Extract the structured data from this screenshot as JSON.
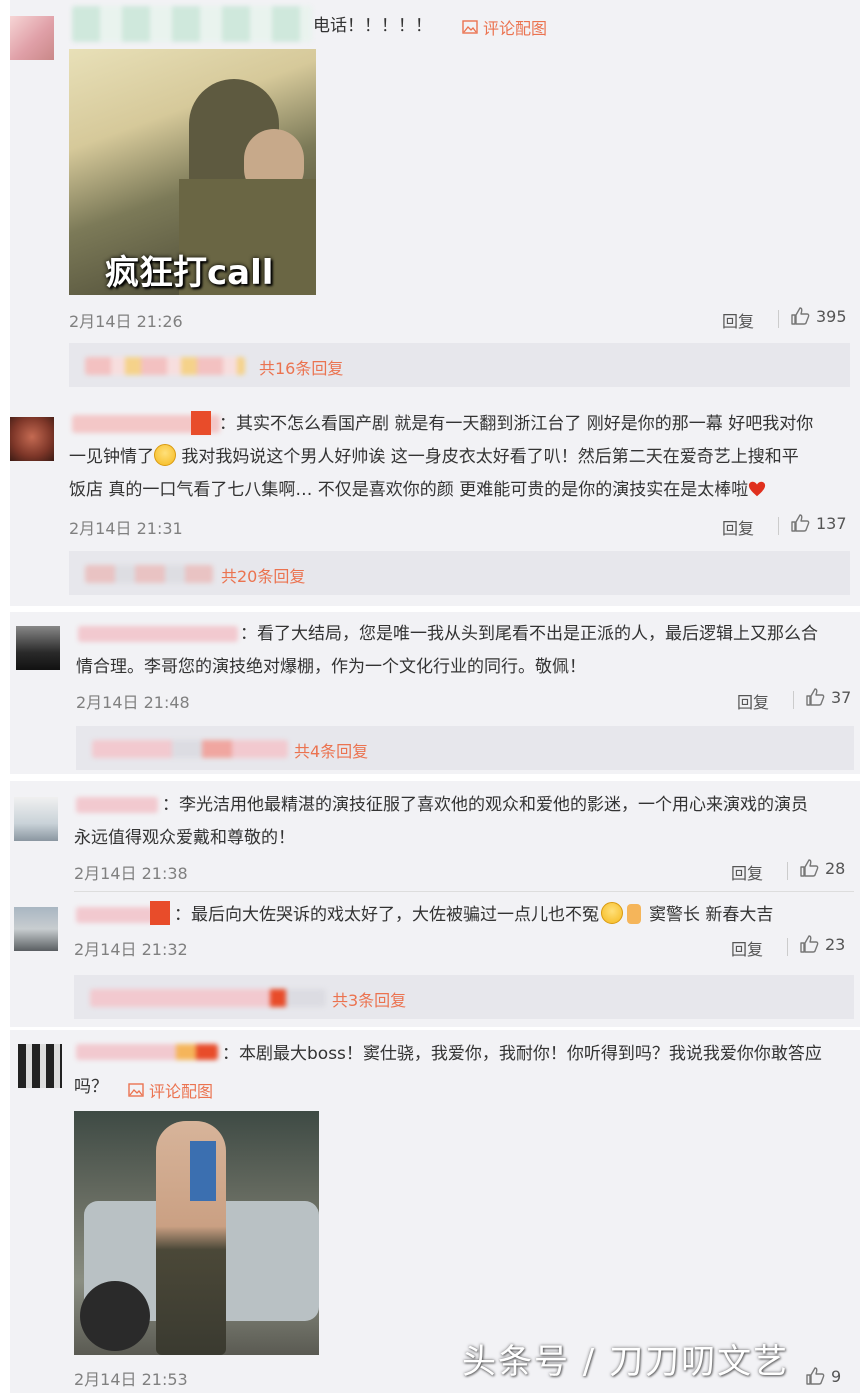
{
  "comments": [
    {
      "text_lines": [
        "电话！！！！！"
      ],
      "image_link": "评论配图",
      "image_caption": "疯狂打call",
      "time": "2月14日 21:26",
      "reply_label": "回复",
      "likes": "395",
      "reply_count": "共16条回复"
    },
    {
      "text_lines": [
        "：其实不怎么看国产剧 就是有一天翻到浙江台了 刚好是你的那一幕 好吧我对你",
        "一见钟情了",
        " 我对我妈说这个男人好帅诶 这一身皮衣太好看了叭！然后第二天在爱奇艺上搜和平",
        "饭店 真的一口气看了七八集啊… 不仅是喜欢你的颜 更难能可贵的是你的演技实在是太棒啦"
      ],
      "time": "2月14日 21:31",
      "reply_label": "回复",
      "likes": "137",
      "reply_count": "共20条回复"
    },
    {
      "text_lines": [
        "：看了大结局，您是唯一我从头到尾看不出是正派的人，最后逻辑上又那么合",
        "情合理。李哥您的演技绝对爆棚，作为一个文化行业的同行。敬佩！"
      ],
      "time": "2月14日 21:48",
      "reply_label": "回复",
      "likes": "37",
      "reply_count": "共4条回复"
    },
    {
      "text_lines": [
        "：李光洁用他最精湛的演技征服了喜欢他的观众和爱他的影迷，一个用心来演戏的演员",
        "永远值得观众爱戴和尊敬的！"
      ],
      "time": "2月14日 21:38",
      "reply_label": "回复",
      "likes": "28"
    },
    {
      "text_lines": [
        "：最后向大佐哭诉的戏太好了，大佐被骗过一点儿也不冤",
        "窦警长 新春大吉"
      ],
      "time": "2月14日 21:32",
      "reply_label": "回复",
      "likes": "23",
      "reply_count": "共3条回复"
    },
    {
      "text_lines": [
        "：本剧最大boss！窦仕骁，我爱你，我耐你！你听得到吗？我说我爱你你敢答应",
        "吗？"
      ],
      "image_link": "评论配图",
      "time": "2月14日 21:53",
      "likes": "9"
    }
  ],
  "watermark": "头条号 / 刀刀叨文艺",
  "colors": {
    "accent": "#eb7350",
    "panel": "#f2f2f5",
    "reply_box": "#e7e7ec"
  }
}
